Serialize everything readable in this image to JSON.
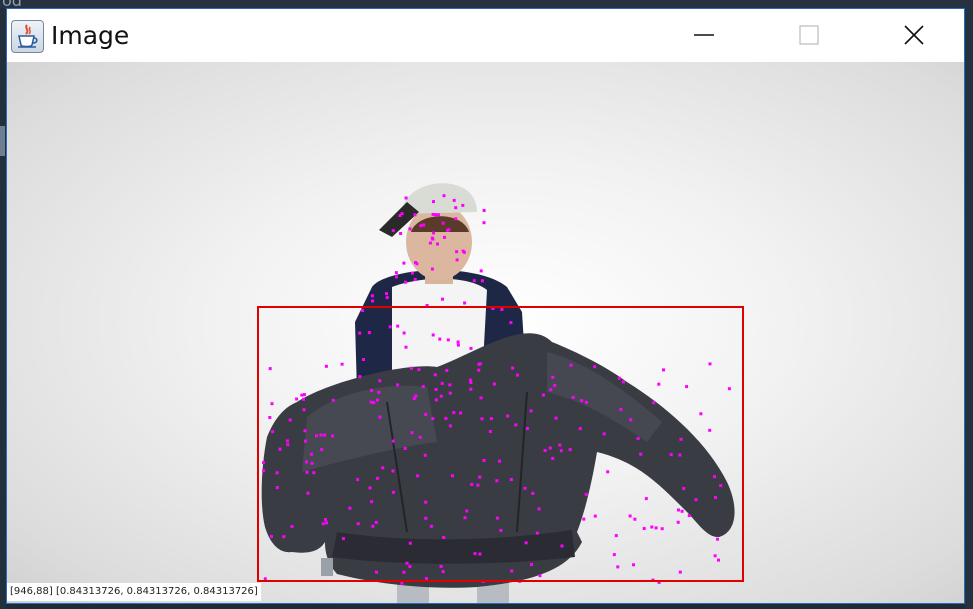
{
  "window": {
    "title": "Image",
    "icon": "java-cup-icon",
    "controls": [
      "minimize-icon",
      "maximize-icon",
      "close-icon"
    ]
  },
  "status": {
    "readout": "[946,88] [0.84313726, 0.84313726, 0.84313726]"
  },
  "background_fragment": {
    "text": "od"
  },
  "colors": {
    "bounding_box": "#e00000",
    "keypoints": "#ff00ff",
    "window_border": "#2b6bbf"
  }
}
